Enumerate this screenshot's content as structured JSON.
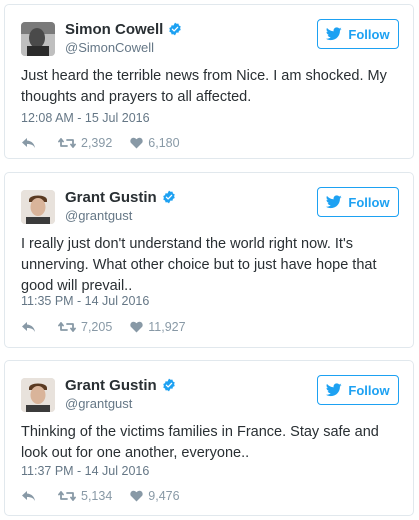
{
  "follow_label": "Follow",
  "accent_color": "#1da1f2",
  "tweets": [
    {
      "name": "Simon Cowell",
      "handle": "@SimonCowell",
      "verified": true,
      "text": "Just heard the terrible news from Nice. I am shocked. My thoughts and prayers to all affected.",
      "timestamp": "12:08 AM - 15 Jul 2016",
      "retweets": "2,392",
      "likes": "6,180"
    },
    {
      "name": "Grant Gustin",
      "handle": "@grantgust",
      "verified": true,
      "text": "I really just don't understand the world right now. It's unnerving. What other choice but to just have hope that good will prevail..",
      "timestamp": "11:35 PM - 14 Jul 2016",
      "retweets": "7,205",
      "likes": "11,927"
    },
    {
      "name": "Grant Gustin",
      "handle": "@grantgust",
      "verified": true,
      "text": "Thinking of the victims families in France. Stay safe and look out for one another, everyone..",
      "timestamp": "11:37 PM - 14 Jul 2016",
      "retweets": "5,134",
      "likes": "9,476"
    }
  ]
}
